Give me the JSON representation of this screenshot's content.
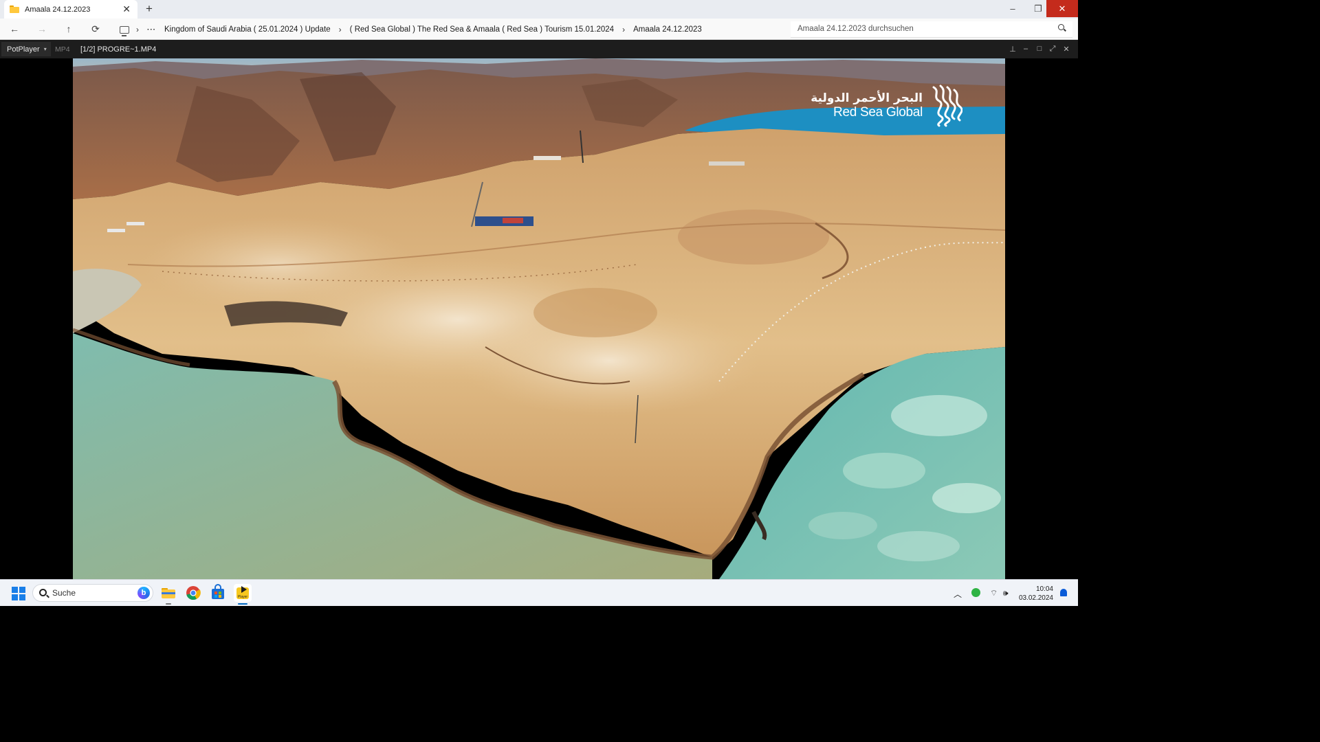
{
  "explorer": {
    "tab_title": "Amaala 24.12.2023",
    "tab_close": "✕",
    "new_tab": "+",
    "window_controls": {
      "minimize": "–",
      "restore": "❐",
      "close": "✕"
    },
    "nav": {
      "back": "←",
      "forward": "→",
      "up": "↑",
      "refresh": "⟳"
    },
    "breadcrumb_overflow": "···",
    "breadcrumb_separator": "›",
    "breadcrumbs": [
      "Kingdom of Saudi Arabia ( 25.01.2024 ) Update",
      "( Red Sea Global ) The Red Sea & Amaala ( Red Sea ) Tourism 15.01.2024",
      "Amaala 24.12.2023"
    ],
    "search_placeholder": "Amaala 24.12.2023 durchsuchen"
  },
  "player": {
    "menu_label": "PotPlayer",
    "menu_caret": "▾",
    "format": "MP4",
    "file_label": "[1/2] PROGRE~1.MP4",
    "controls": {
      "pin": "⊥",
      "minimize": "–",
      "maximize": "□",
      "fullscreen": "⤢",
      "close": "✕"
    },
    "overlay_logo": {
      "arabic": "البحر الأحمر الدولية",
      "english": "Red Sea Global"
    }
  },
  "taskbar": {
    "search_label": "Suche",
    "bing_label": "b",
    "potplayer_label": "Player",
    "tray": {
      "chevron": "︿",
      "wifi": "⌔",
      "volume": "🕪"
    },
    "time": "10:04",
    "date": "03.02.2024"
  },
  "colors": {
    "accent_close": "#c42b1c",
    "sea_turquoise": "#5ec3c4",
    "lagoon_blue": "#1d8fc2",
    "desert_sand": "#d7a66a",
    "mountain_brown": "#8a5a3f"
  }
}
